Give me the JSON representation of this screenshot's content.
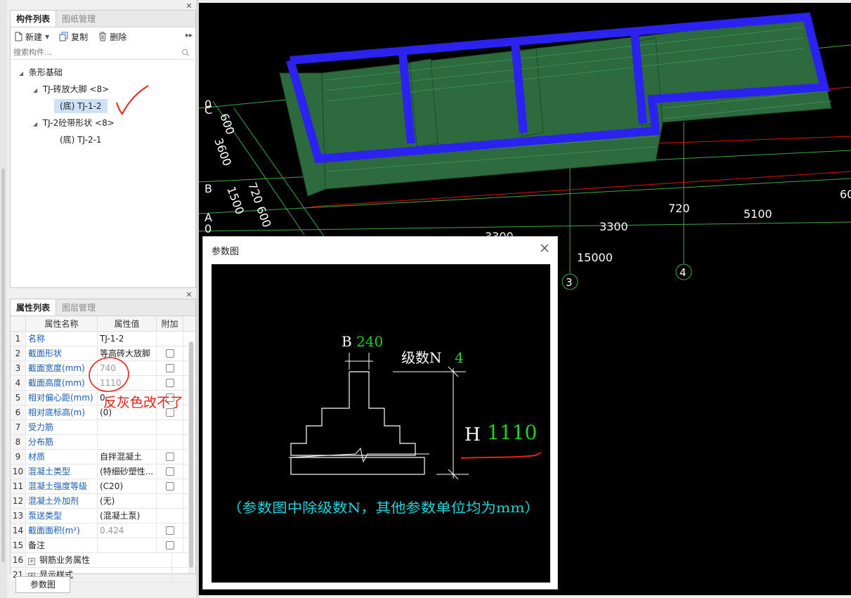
{
  "component_panel": {
    "tabs": [
      "构件列表",
      "图纸管理"
    ],
    "toolbar": {
      "new": "新建",
      "copy": "复制",
      "delete": "删除"
    },
    "search_placeholder": "搜索构件...",
    "tree": {
      "root": "条形基础",
      "groups": [
        {
          "label": "TJ-砖放大脚 <8>",
          "children": [
            "(底) TJ-1-2"
          ]
        },
        {
          "label": "TJ-2砼带形状 <8>",
          "children": [
            "(底) TJ-2-1"
          ]
        }
      ]
    }
  },
  "property_panel": {
    "tabs": [
      "属性列表",
      "图层管理"
    ],
    "headers": {
      "name": "属性名称",
      "value": "属性值",
      "extra": "附加"
    },
    "rows": [
      {
        "n": "1",
        "name": "名称",
        "value": "TJ-1-2"
      },
      {
        "n": "2",
        "name": "截面形状",
        "value": "等高砖大放脚"
      },
      {
        "n": "3",
        "name": "截面宽度(mm)",
        "value": "740"
      },
      {
        "n": "4",
        "name": "截面高度(mm)",
        "value": "1110"
      },
      {
        "n": "5",
        "name": "相对偏心距(mm)",
        "value": "0"
      },
      {
        "n": "6",
        "name": "相对底标高(m)",
        "value": "(0)"
      },
      {
        "n": "7",
        "name": "受力筋",
        "value": ""
      },
      {
        "n": "8",
        "name": "分布筋",
        "value": ""
      },
      {
        "n": "9",
        "name": "材质",
        "value": "自拌混凝土"
      },
      {
        "n": "10",
        "name": "混凝土类型",
        "value": "(特细砂塑性..."
      },
      {
        "n": "11",
        "name": "混凝土强度等级",
        "value": "(C20)"
      },
      {
        "n": "12",
        "name": "混凝土外加剂",
        "value": "(无)"
      },
      {
        "n": "13",
        "name": "泵送类型",
        "value": "(混凝土泵)"
      },
      {
        "n": "14",
        "name": "截面面积(m²)",
        "value": "0.424"
      },
      {
        "n": "15",
        "name": "备注",
        "value": ""
      },
      {
        "n": "16",
        "name": "钢筋业务属性",
        "value": ""
      },
      {
        "n": "21",
        "name": "显示样式",
        "value": ""
      }
    ],
    "param_button": "参数图"
  },
  "viewport": {
    "axis_labels": [
      "C",
      "B",
      "A",
      "0",
      "0",
      "3",
      "4"
    ],
    "dims": [
      "600",
      "3600",
      "720",
      "1500",
      "600",
      "720",
      "5100",
      "3300",
      "3300",
      "15000",
      "60"
    ]
  },
  "dialog": {
    "title": "参数图",
    "B_label": "B",
    "B_value": "240",
    "N_label": "级数N",
    "N_value": "4",
    "H_label": "H",
    "H_value": "1110",
    "note": "（参数图中除级数N，其他参数单位均为mm）"
  },
  "annotation": "反灰色改不了",
  "colors": {
    "wall_green": "#2d6b3e",
    "beam_blue": "#2b22f0",
    "axis_green": "#3fa84a",
    "dim_green": "#1ed11e",
    "note_cyan": "#1fd3d8",
    "annot_red": "#e8221b"
  }
}
